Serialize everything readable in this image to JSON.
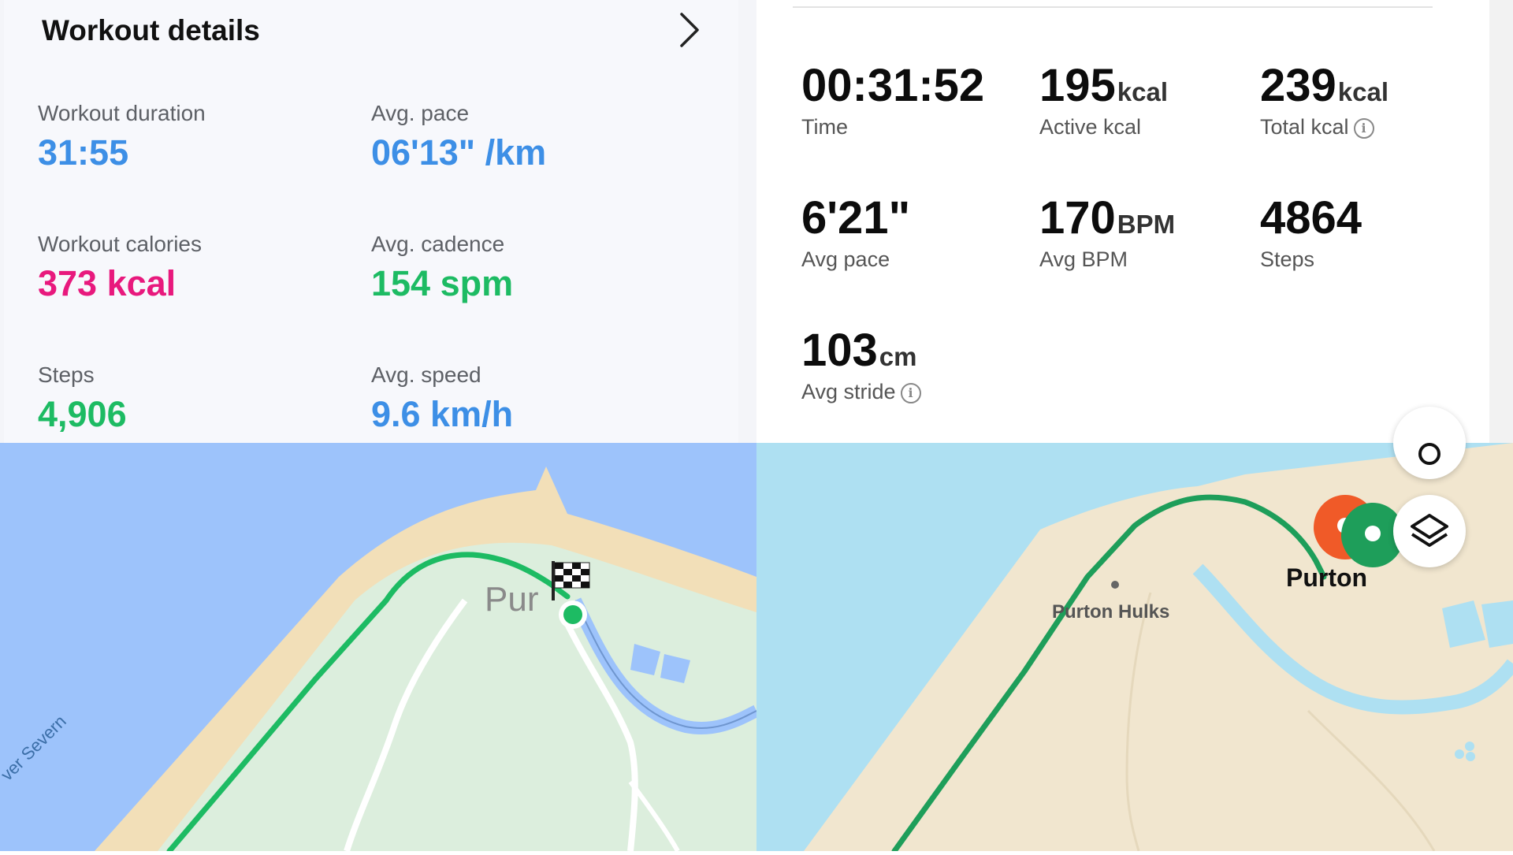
{
  "left_panel": {
    "title": "Workout details",
    "stats": [
      {
        "label": "Workout duration",
        "value": "31:55",
        "color": "#3d8fe6"
      },
      {
        "label": "Avg. pace",
        "value": "06'13\" /km",
        "color": "#3d8fe6"
      },
      {
        "label": "Workout calories",
        "value": "373 kcal",
        "color": "#e8197d"
      },
      {
        "label": "Avg. cadence",
        "value": "154 spm",
        "color": "#1dbb63"
      },
      {
        "label": "Steps",
        "value": "4,906",
        "color": "#1dbb63"
      },
      {
        "label": "Avg. speed",
        "value": "9.6 km/h",
        "color": "#3d8fe6"
      }
    ]
  },
  "right_panel": {
    "stats": [
      {
        "value": "00:31:52",
        "unit": "",
        "label": "Time"
      },
      {
        "value": "195",
        "unit": "kcal",
        "label": "Active kcal"
      },
      {
        "value": "239",
        "unit": "kcal",
        "label": "Total kcal"
      },
      {
        "value": "6'21\"",
        "unit": "",
        "label": "Avg pace"
      },
      {
        "value": "170",
        "unit": "BPM",
        "label": "Avg BPM"
      },
      {
        "value": "4864",
        "unit": "",
        "label": "Steps"
      },
      {
        "value": "103",
        "unit": "cm",
        "label": "Avg stride"
      }
    ]
  },
  "map_left": {
    "place_label": "Pur",
    "river_label": "ver Severn",
    "route_color": "#1dbb63",
    "water_color": "#9dc3fb"
  },
  "map_right": {
    "place_label": "Purton",
    "hulks_label": "Purton Hulks",
    "route_color": "#1e9e5a",
    "start_pin_color": "#f05a28",
    "end_pin_color": "#1e9e5a",
    "layers_button_icon": "layers-icon"
  }
}
